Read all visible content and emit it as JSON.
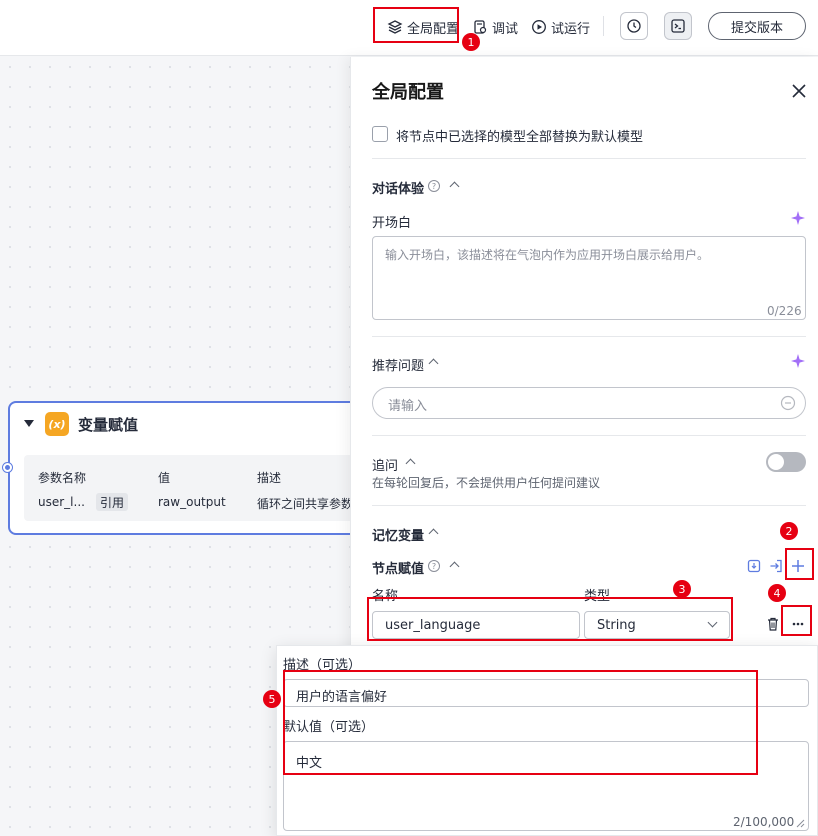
{
  "toolbar": {
    "global_config": "全局配置",
    "debug": "调试",
    "test_run": "试运行",
    "submit_version": "提交版本"
  },
  "node": {
    "icon_text": "(x)",
    "title": "变量赋值",
    "col_name": "参数名称",
    "col_value": "值",
    "col_desc": "描述",
    "row_name": "user_l...",
    "row_tag": "引用",
    "row_value": "raw_output",
    "row_desc": "循环之间共享参数"
  },
  "panel": {
    "title": "全局配置",
    "replace_models": "将节点中已选择的模型全部替换为默认模型",
    "dialog_experience": "对话体验",
    "opening": "开场白",
    "opening_placeholder": "输入开场白，该描述将在气泡内作为应用开场白展示给用户。",
    "opening_count": "0/226",
    "suggested_questions": "推荐问题",
    "suggested_placeholder": "请输入",
    "follow_up": "追问",
    "follow_up_desc": "在每轮回复后，不会提供用户任何提问建议",
    "memory_vars": "记忆变量",
    "node_assign": "节点赋值",
    "col_name": "名称",
    "col_type": "类型",
    "var_name": "user_language",
    "var_type": "String"
  },
  "popover": {
    "desc_label": "描述（可选）",
    "desc_value": "用户的语言偏好",
    "default_label": "默认值（可选）",
    "default_value": "中文",
    "default_count": "2/100,000"
  },
  "annotations": [
    "1",
    "2",
    "3",
    "4",
    "5"
  ],
  "colors": {
    "accent": "#5e7ce0",
    "annotation": "#e60012",
    "node_icon": "#f5a623"
  }
}
